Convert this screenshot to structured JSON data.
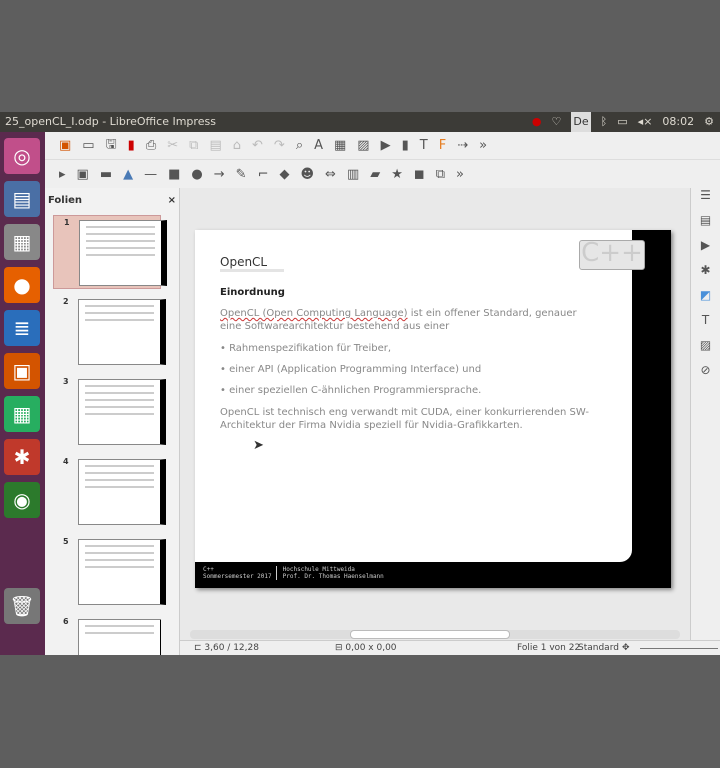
{
  "window_title": "25_openCL_I.odp - LibreOffice Impress",
  "tray": {
    "keyboard": "De",
    "clock": "08:02"
  },
  "panel": {
    "title": "Folien",
    "close": "×",
    "slides": [
      "1",
      "2",
      "3",
      "4",
      "5",
      "6"
    ]
  },
  "slide": {
    "title": "OpenCL",
    "logo": "C++",
    "heading": "Einordnung",
    "para1_a": "OpenCL (Open Computing Language)",
    "para1_b": " ist ein offener Standard, genauer eine Softwarearchitektur bestehend aus einer",
    "bullets": [
      "• Rahmenspezifikation für Treiber,",
      "• einer API (Application Programming Interface) und",
      "• einer speziellen C-ähnlichen Programmiersprache."
    ],
    "para2": "OpenCL ist technisch eng verwandt mit CUDA, einer konkurrierenden SW-Architektur der Firma Nvidia speziell für Nvidia-Grafikkarten.",
    "footer": {
      "course": "C++",
      "semester": "Sommersemester 2017",
      "school": "Hochschule Mittweida",
      "author": "Prof. Dr. Thomas Haenselmann"
    }
  },
  "status": {
    "position": "3,60 / 12,28",
    "size": "0,00 x 0,00",
    "slide": "Folie 1 von 22",
    "layout": "Standard"
  }
}
